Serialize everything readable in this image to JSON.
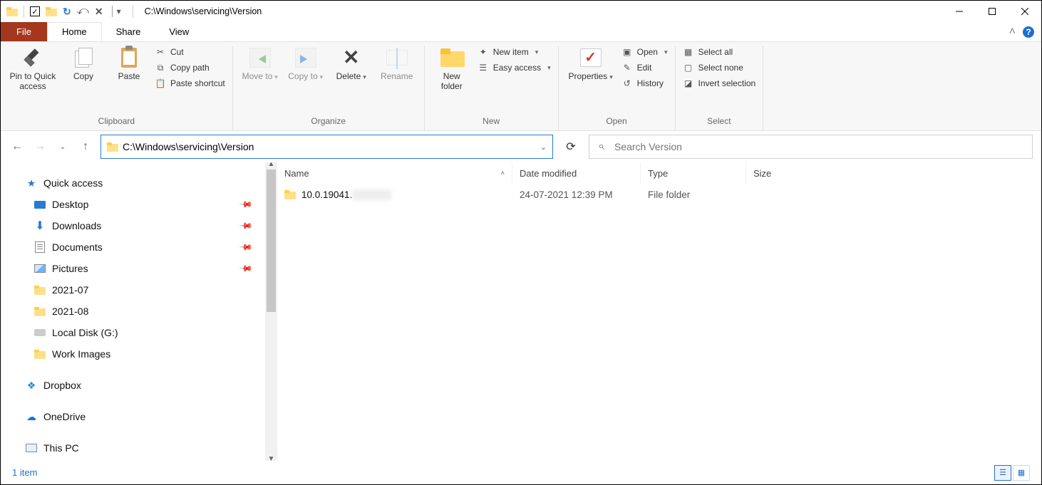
{
  "title_path": "C:\\Windows\\servicing\\Version",
  "tabs": {
    "file": "File",
    "home": "Home",
    "share": "Share",
    "view": "View"
  },
  "ribbon": {
    "clipboard": {
      "title": "Clipboard",
      "pin": "Pin to Quick access",
      "copy": "Copy",
      "paste": "Paste",
      "cut": "Cut",
      "copy_path": "Copy path",
      "paste_shortcut": "Paste shortcut"
    },
    "organize": {
      "title": "Organize",
      "move_to": "Move to",
      "copy_to": "Copy to",
      "delete": "Delete",
      "rename": "Rename"
    },
    "new": {
      "title": "New",
      "new_folder": "New folder",
      "new_item": "New item",
      "easy_access": "Easy access"
    },
    "open": {
      "title": "Open",
      "properties": "Properties",
      "open": "Open",
      "edit": "Edit",
      "history": "History"
    },
    "select": {
      "title": "Select",
      "all": "Select all",
      "none": "Select none",
      "invert": "Invert selection"
    }
  },
  "address": "C:\\Windows\\servicing\\Version",
  "search_placeholder": "Search Version",
  "columns": {
    "name": "Name",
    "date": "Date modified",
    "type": "Type",
    "size": "Size"
  },
  "rows": [
    {
      "name_visible": "10.0.19041.",
      "date": "24-07-2021 12:39 PM",
      "type": "File folder"
    }
  ],
  "sidebar": {
    "quick_access": "Quick access",
    "items2": [
      "Desktop",
      "Downloads",
      "Documents",
      "Pictures",
      "2021-07",
      "2021-08",
      "Local Disk (G:)",
      "Work Images"
    ],
    "dropbox": "Dropbox",
    "onedrive": "OneDrive",
    "thispc": "This PC"
  },
  "status": "1 item"
}
